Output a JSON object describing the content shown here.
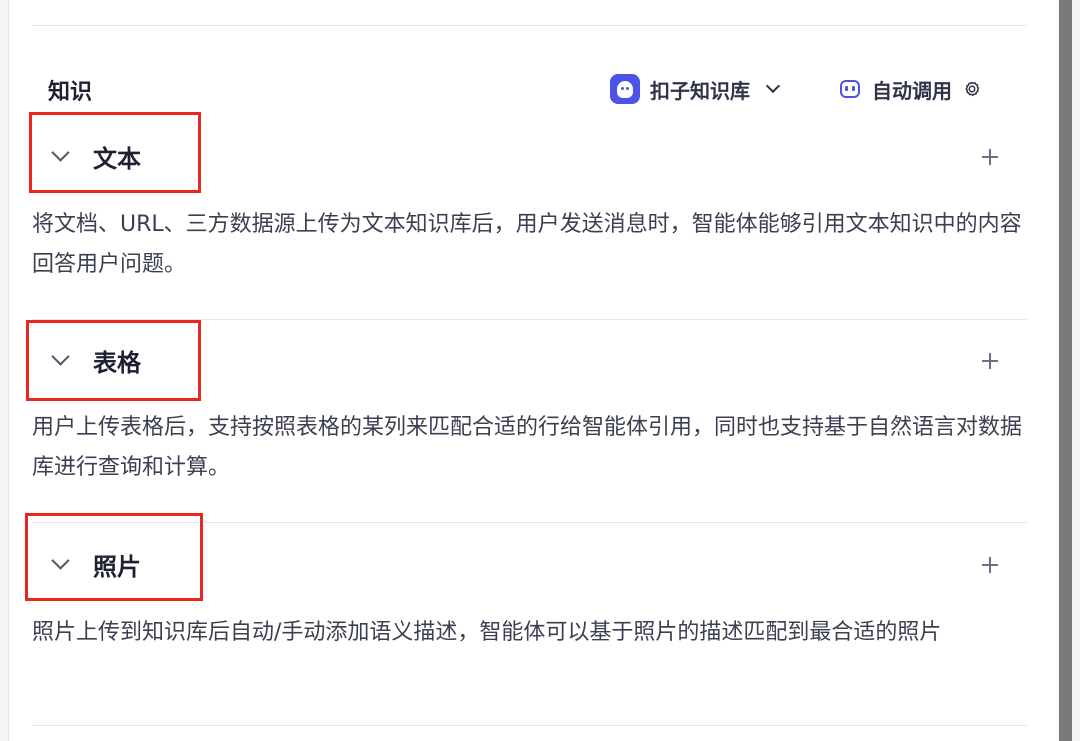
{
  "knowledge": {
    "title": "知识",
    "kb_selector": {
      "label": "扣子知识库",
      "icon": "coze-bot-logo",
      "brand_color": "#4d53e8"
    },
    "invoke_mode": {
      "label": "自动调用",
      "icon": "robot-icon"
    }
  },
  "groups": [
    {
      "title": "文本",
      "description": "将文档、URL、三方数据源上传为文本知识库后，用户发送消息时，智能体能够引用文本知识中的内容回答用户问题。"
    },
    {
      "title": "表格",
      "description": "用户上传表格后，支持按照表格的某列来匹配合适的行给智能体引用，同时也支持基于自然语言对数据库进行查询和计算。"
    },
    {
      "title": "照片",
      "description": "照片上传到知识库后自动/手动添加语义描述，智能体可以基于照片的描述匹配到最合适的照片"
    }
  ],
  "highlight_color": "#e8271f"
}
